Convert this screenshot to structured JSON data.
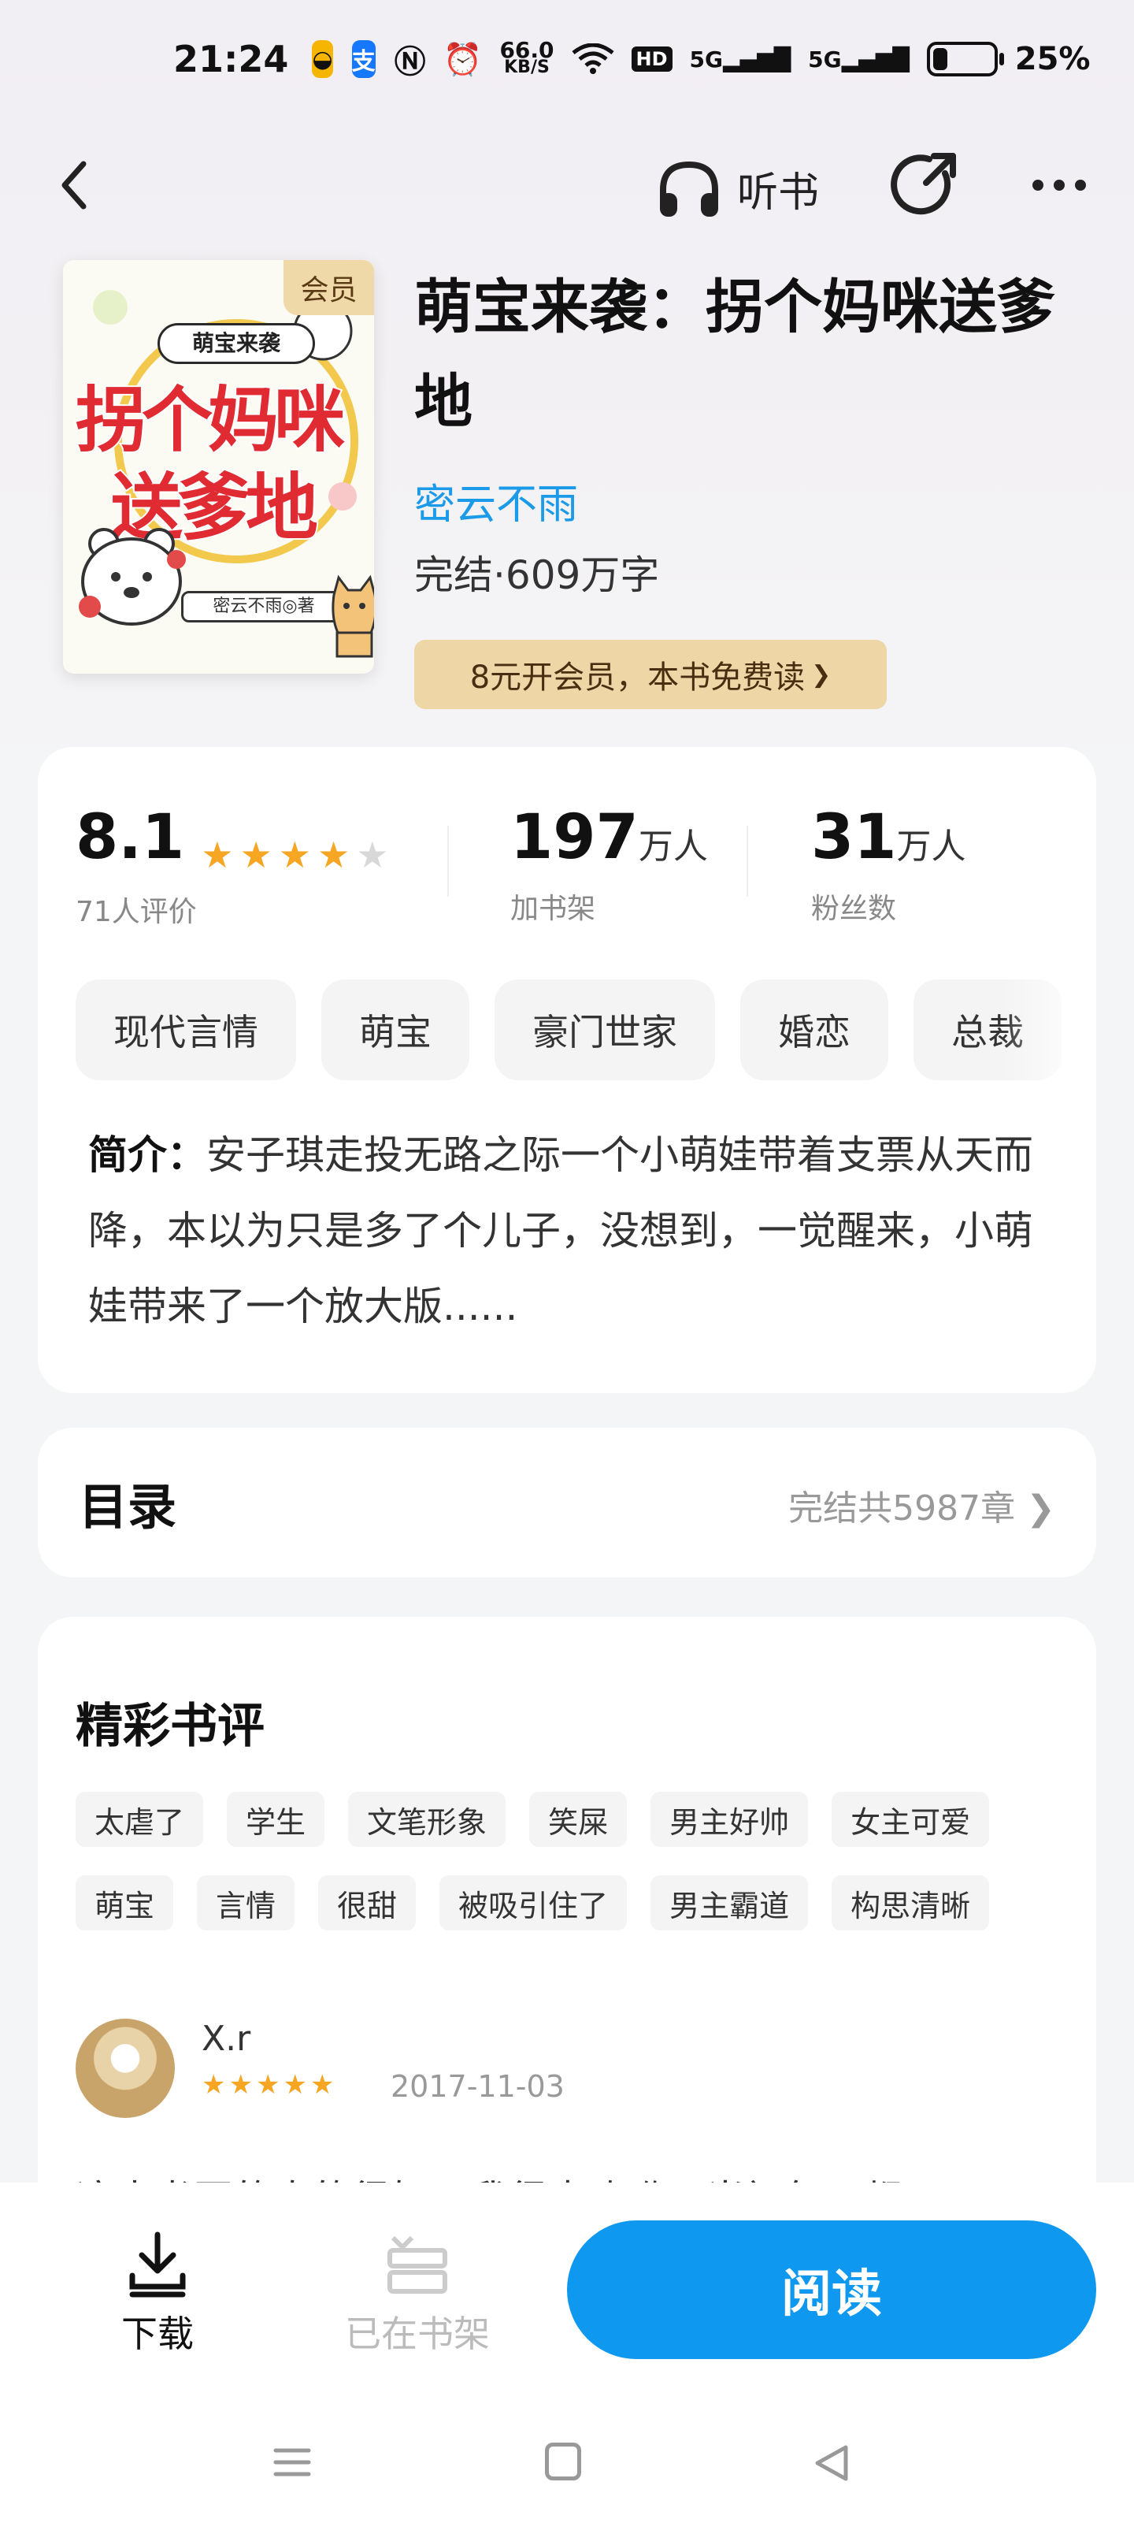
{
  "status_bar": {
    "time": "21:24",
    "net_speed": "66.0",
    "net_unit": "KB/S",
    "signal_label_1": "5G",
    "signal_label_2": "5G",
    "hd_label": "HD",
    "battery": "25%",
    "battery_level": 0.25
  },
  "nav": {
    "listen_label": "听书"
  },
  "book": {
    "cover_badge": "会员",
    "cover_small_title": "萌宝来袭",
    "cover_big_line1": "拐个妈咪",
    "cover_big_line2": "送爹地",
    "cover_author_tag": "密云不雨◎著",
    "title": "萌宝来袭：拐个妈咪送爹地",
    "author": "密云不雨",
    "meta": "完结·609万字",
    "vip_offer": "8元开会员，本书免费读",
    "vip_arrow": "❯"
  },
  "stats": {
    "rating": "8.1",
    "rating_stars": 4,
    "rating_label": "71人评价",
    "shelf_num": "197",
    "shelf_unit": "万人",
    "shelf_label": "加书架",
    "fans_num": "31",
    "fans_unit": "万人",
    "fans_label": "粉丝数"
  },
  "tags": [
    "现代言情",
    "萌宝",
    "豪门世家",
    "婚恋",
    "总裁"
  ],
  "intro": {
    "label": "简介：",
    "text": "安子琪走投无路之际一个小萌娃带着支票从天而降，本以为只是多了个儿子，没想到，一觉醒来，小萌娃带来了一个放大版......"
  },
  "toc": {
    "title": "目录",
    "info": "完结共5987章 ❯"
  },
  "reviews": {
    "title": "精彩书评",
    "tags": [
      "太虐了",
      "学生",
      "文笔形象",
      "笑屎",
      "男主好帅",
      "女主可爱",
      "萌宝",
      "言情",
      "很甜",
      "被吸引住了",
      "男主霸道",
      "构思清晰"
    ],
    "first": {
      "user": "X.r",
      "stars": 5,
      "date": "2017-11-03",
      "text": "这本书写的真的很好，我很喜欢哟，当初每天都"
    }
  },
  "bottom": {
    "download_label": "下载",
    "shelf_label": "已在书架",
    "read_label": "阅读"
  },
  "colors": {
    "accent_blue": "#0f98ef",
    "author_blue": "#1a9ae8",
    "vip_gold": "#eed6a6",
    "star_orange": "#f6a623"
  }
}
